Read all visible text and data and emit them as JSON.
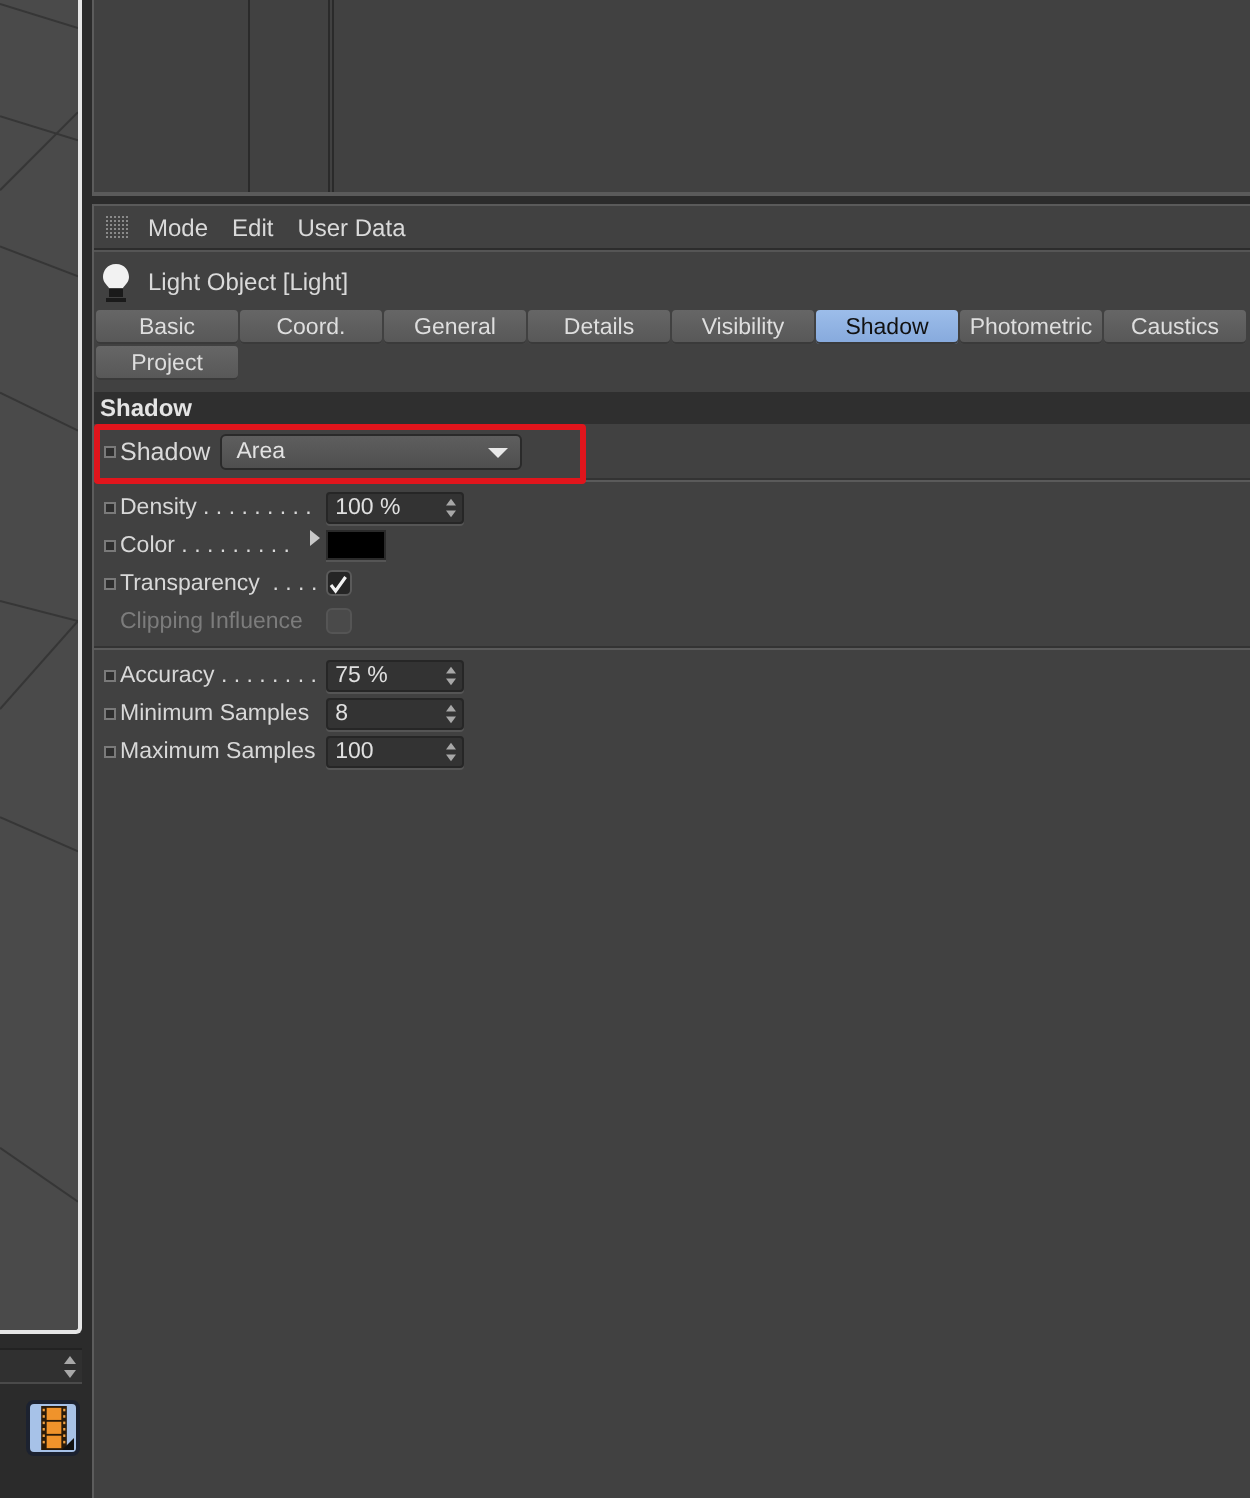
{
  "left_toolbar": {
    "film_button": {
      "selected": true
    }
  },
  "menu": [
    "Mode",
    "Edit",
    "User Data"
  ],
  "object": {
    "title": "Light Object [Light]"
  },
  "tabs": [
    {
      "label": "Basic",
      "selected": false
    },
    {
      "label": "Coord.",
      "selected": false
    },
    {
      "label": "General",
      "selected": false
    },
    {
      "label": "Details",
      "selected": false
    },
    {
      "label": "Visibility",
      "selected": false
    },
    {
      "label": "Shadow",
      "selected": true
    },
    {
      "label": "Photometric",
      "selected": false
    },
    {
      "label": "Caustics",
      "selected": false
    },
    {
      "label": "Project",
      "selected": false
    }
  ],
  "section": {
    "title": "Shadow"
  },
  "shadow_row": {
    "label": "Shadow",
    "value": "Area",
    "highlighted": true
  },
  "groups": [
    [
      {
        "kind": "number",
        "label": "Density . . . . . . . . .",
        "value": "100 %",
        "disabled": false
      },
      {
        "kind": "color",
        "label": "Color . . . . . . . . .",
        "color": "#000000",
        "expanded": false,
        "disabled": false
      },
      {
        "kind": "checkbox",
        "label": "Transparency  . . . .",
        "checked": true,
        "disabled": false
      },
      {
        "kind": "checkbox",
        "label": "Clipping Influence",
        "checked": false,
        "disabled": true
      }
    ],
    [
      {
        "kind": "number",
        "label": "Accuracy . . . . . . . .",
        "value": "75 %",
        "disabled": false
      },
      {
        "kind": "number",
        "label": "Minimum Samples",
        "value": "8",
        "disabled": false
      },
      {
        "kind": "number",
        "label": "Maximum Samples",
        "value": "100",
        "disabled": false
      }
    ]
  ]
}
